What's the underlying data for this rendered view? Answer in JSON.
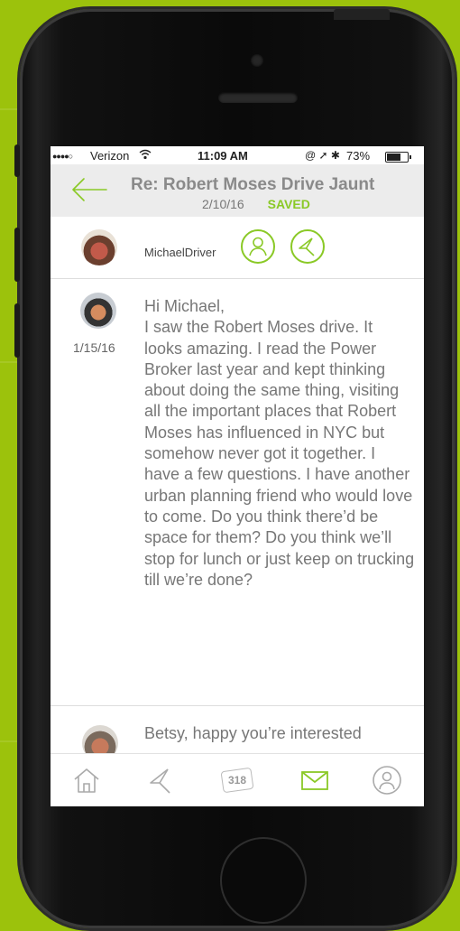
{
  "status_bar": {
    "signal": "●●●●○",
    "carrier": "Verizon",
    "wifi_icon": "wifi-icon",
    "time": "11:09 AM",
    "system_icons": "@ ➚ ✱",
    "battery": "73%",
    "battery_level": 0.73
  },
  "header": {
    "back_icon": "back-arrow-icon",
    "subject": "Re: Robert Moses Drive Jaunt",
    "date": "2/10/16",
    "status": "SAVED"
  },
  "participants": {
    "name": "MichaelDriver",
    "actions": [
      "profile-icon",
      "navigation-icon"
    ]
  },
  "messages": [
    {
      "date": "1/15/16",
      "body": "Hi Michael,\nI saw the Robert Moses drive. It looks amazing. I read the Power Broker last year and kept thinking about doing the same thing, visiting all the important places that Robert Moses has influenced in NYC but somehow never got it together. I have a few questions. I have another urban planning friend who would love to come. Do you think there’d be space for them? Do you think we’ll stop for lunch or just keep on trucking till we’re done?"
    },
    {
      "date": "",
      "body": "Betsy, happy you’re interested"
    }
  ],
  "tabbar": {
    "tabs": [
      "home-icon",
      "navigation-icon",
      "points-badge",
      "mail-icon",
      "profile-icon"
    ],
    "badge_value": "318",
    "active": "mail-icon"
  },
  "colors": {
    "background": "#9cc20c",
    "accent": "#8ac926",
    "header_bg": "#ececec",
    "text": "#777777"
  }
}
